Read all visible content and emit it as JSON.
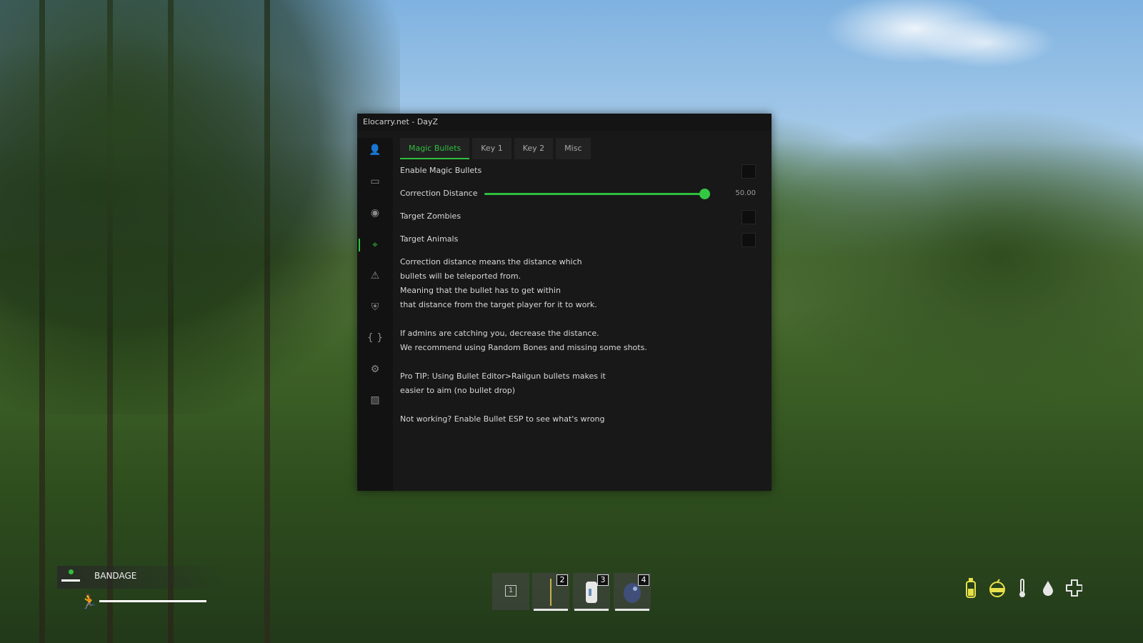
{
  "window": {
    "title": "Elocarry.net - DayZ"
  },
  "sidebar": {
    "items": [
      {
        "icon": "user-icon",
        "glyph": "👤"
      },
      {
        "icon": "inventory-icon",
        "glyph": "▭"
      },
      {
        "icon": "eye-icon",
        "glyph": "◉"
      },
      {
        "icon": "crosshair-icon",
        "glyph": "⌖"
      },
      {
        "icon": "warning-icon",
        "glyph": "⚠"
      },
      {
        "icon": "shield-icon",
        "glyph": "⛨"
      },
      {
        "icon": "code-icon",
        "glyph": "{ }"
      },
      {
        "icon": "gear-icon",
        "glyph": "⚙"
      },
      {
        "icon": "image-icon",
        "glyph": "▨"
      }
    ],
    "active_index": 3
  },
  "tabs": [
    "Magic Bullets",
    "Key 1",
    "Key 2",
    "Misc"
  ],
  "settings": {
    "enable_magic_bullets": {
      "label": "Enable Magic Bullets",
      "checked": false
    },
    "correction_distance": {
      "label": "Correction Distance",
      "value": "50.00",
      "fraction": 1.0
    },
    "target_zombies": {
      "label": "Target Zombies",
      "checked": false
    },
    "target_animals": {
      "label": "Target Animals",
      "checked": false
    }
  },
  "description": {
    "lines": [
      "Correction distance means the distance which",
      "bullets will be teleported from.",
      "Meaning that the bullet has to get within",
      "that distance from the target player for it to work.",
      "",
      "If admins are catching you, decrease the distance.",
      "We recommend using Random Bones and missing some shots.",
      "",
      "Pro TIP: Using Bullet Editor>Railgun bullets makes it",
      "easier to aim (no bullet drop)",
      "",
      "Not working? Enable Bullet ESP to see what's wrong"
    ]
  },
  "hud": {
    "bandage_label": "BANDAGE",
    "hotbar": [
      {
        "number": "1",
        "item": ""
      },
      {
        "number": "2",
        "item": "stick"
      },
      {
        "number": "3",
        "item": "can"
      },
      {
        "number": "4",
        "item": "stone"
      }
    ],
    "status_icons": [
      "water-bottle-icon",
      "food-icon",
      "thermometer-icon",
      "blood-drop-icon",
      "health-cross-icon"
    ]
  },
  "colors": {
    "accent": "#2fbf3e",
    "panel": "#181818",
    "hud_status": "#e8e04a"
  }
}
